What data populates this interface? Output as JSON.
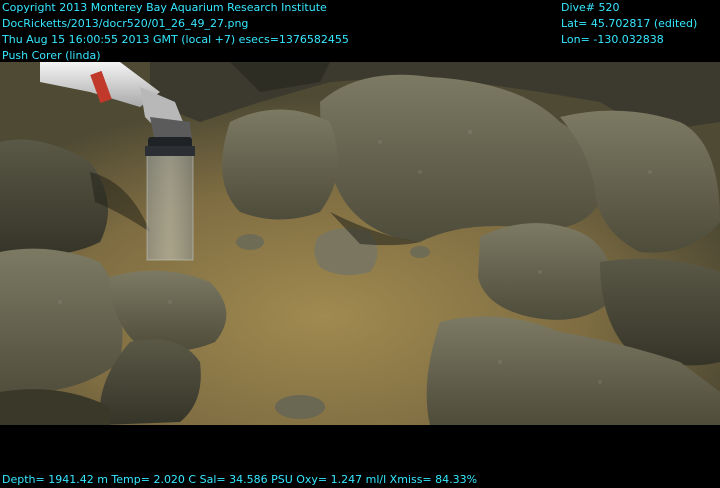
{
  "header_left": {
    "copyright": "Copyright 2013 Monterey Bay Aquarium Research Institute",
    "filename": "DocRicketts/2013/docr520/01_26_49_27.png",
    "timestamp": "Thu Aug 15 16:00:55 2013 GMT (local +7)  esecs=1376582455",
    "tool": "Push Corer (linda)"
  },
  "header_right": {
    "dive": "Dive# 520",
    "lat": "Lat= 45.702817 (edited)",
    "lon": "Lon= -130.032838"
  },
  "footer": {
    "telemetry": "Depth= 1941.42 m  Temp= 2.020 C  Sal= 34.586 PSU  Oxy= 1.247 ml/l  Xmiss= 84.33%"
  },
  "colors": {
    "overlay_text": "#36e8ff",
    "background": "#000000",
    "seafloor": "#6b6545",
    "sediment": "#8a7442"
  }
}
